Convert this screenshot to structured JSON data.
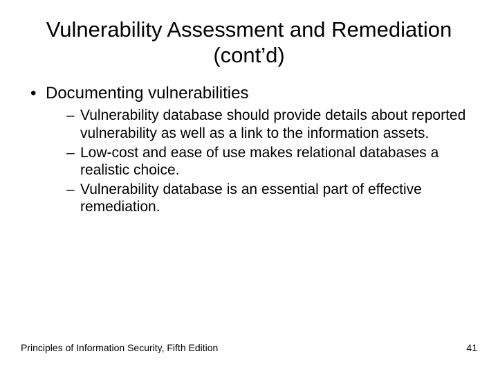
{
  "title": "Vulnerability Assessment and Remediation (cont’d)",
  "bullets": {
    "b1": "Documenting vulnerabilities",
    "s1": "Vulnerability database should provide details about reported vulnerability as well as a link to the information assets.",
    "s2": "Low-cost and ease of use makes relational databases a realistic choice.",
    "s3": "Vulnerability database is an essential part of effective remediation."
  },
  "footer": {
    "left": "Principles of Information Security, Fifth Edition",
    "right": "41"
  }
}
